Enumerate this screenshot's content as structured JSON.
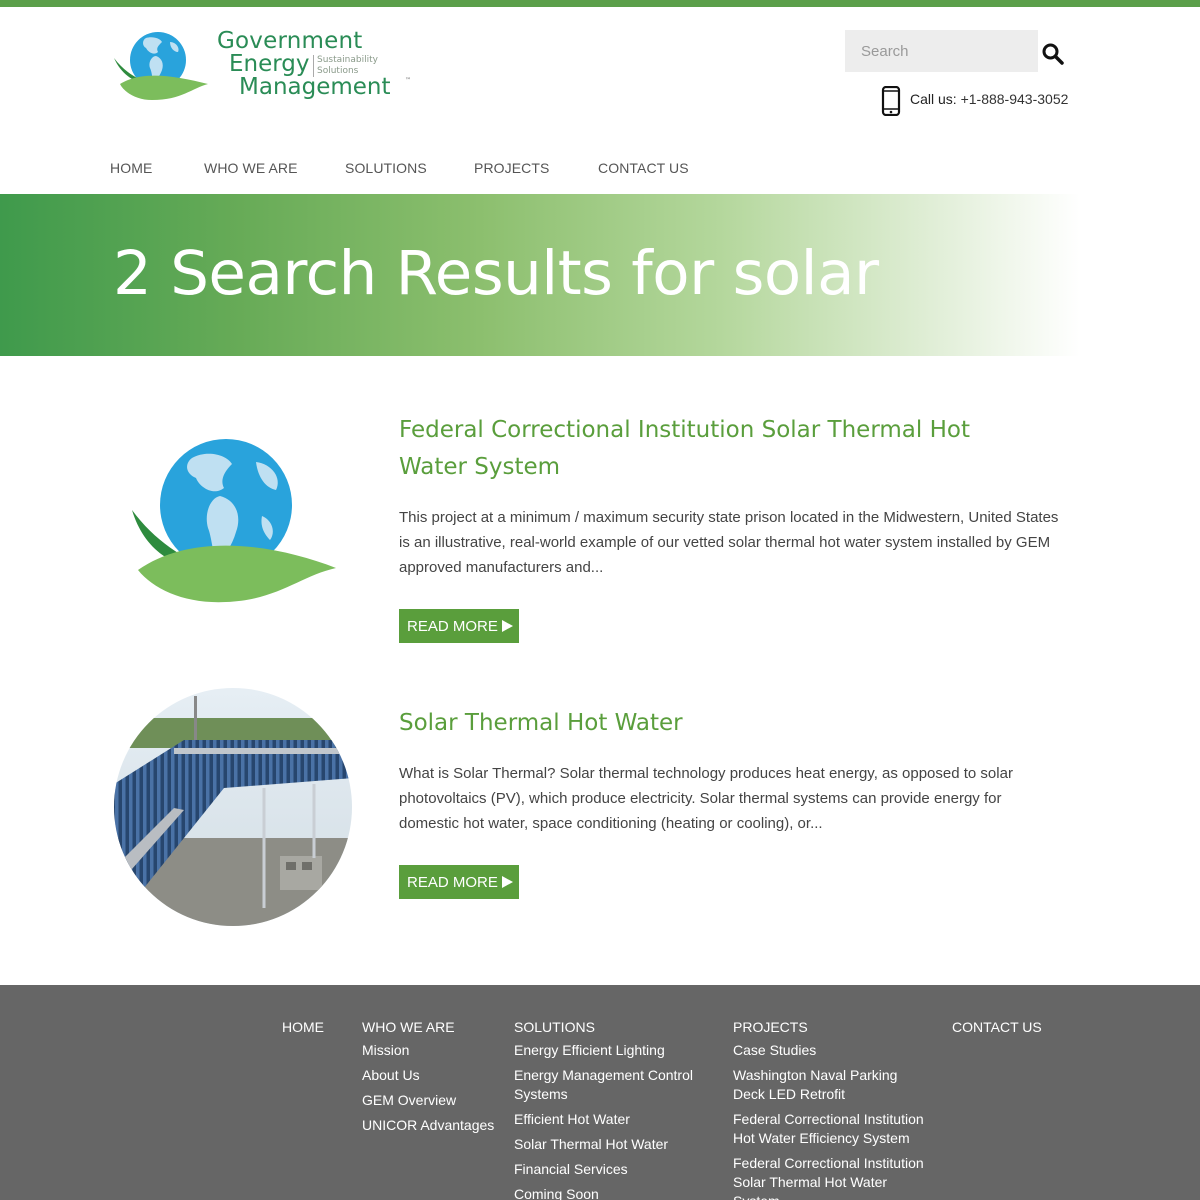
{
  "brand": {
    "name_line1": "Government",
    "name_line2": "Energy",
    "name_line3": "Management",
    "tagline_1": "Sustainability",
    "tagline_2": "Solutions",
    "trademark": "™"
  },
  "search": {
    "placeholder": "Search"
  },
  "contact": {
    "label": "Call us:",
    "phone": "+1-888-943-3052"
  },
  "nav": [
    "HOME",
    "WHO WE ARE",
    "SOLUTIONS",
    "PROJECTS",
    "CONTACT US"
  ],
  "hero": {
    "title": "2 Search Results for solar"
  },
  "results": [
    {
      "title": "Federal Correctional Institution Solar Thermal Hot Water System",
      "excerpt": "This project at a minimum / maximum security state prison located in the Midwestern, United States is an illustrative, real-world example of our vetted solar thermal hot water system installed by GEM approved manufacturers and...",
      "button": "READ MORE",
      "image": "gem-globe-logo"
    },
    {
      "title": "Solar Thermal Hot Water",
      "excerpt": "What is Solar Thermal? Solar thermal technology produces heat energy, as opposed to solar photovoltaics (PV), which produce electricity. Solar thermal systems can provide energy for domestic hot water, space conditioning (heating or cooling), or...",
      "button": "READ MORE",
      "image": "solar-panel-photo"
    }
  ],
  "footer": {
    "columns": [
      {
        "heading": "HOME",
        "links": []
      },
      {
        "heading": "WHO WE ARE",
        "links": [
          "Mission",
          "About Us",
          "GEM Overview",
          "UNICOR Advantages"
        ]
      },
      {
        "heading": "SOLUTIONS",
        "links": [
          "Energy Efficient Lighting",
          "Energy Management Control Systems",
          "Efficient Hot Water",
          "Solar Thermal Hot Water",
          "Financial Services",
          "Coming Soon"
        ]
      },
      {
        "heading": "PROJECTS",
        "links": [
          "Case Studies",
          "Washington Naval Parking Deck LED Retrofit",
          "Federal Correctional Institution Hot Water Efficiency System",
          "Federal Correctional Institution Solar Thermal Hot Water System"
        ]
      },
      {
        "heading": "CONTACT US",
        "links": []
      }
    ]
  },
  "colors": {
    "brand_green": "#5a9e3c",
    "top_bar": "#5b9f4a",
    "footer_bg": "#666666",
    "globe_blue": "#29a3dc"
  },
  "icons": [
    "search-icon",
    "phone-icon",
    "play-arrow-icon"
  ]
}
